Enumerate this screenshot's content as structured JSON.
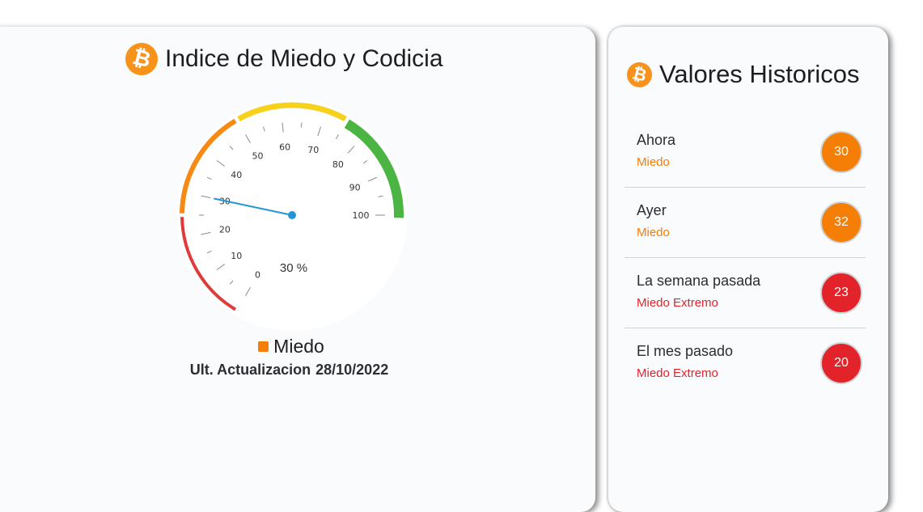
{
  "main": {
    "title": "Indice de Miedo y Codicia",
    "gauge": {
      "value": 30,
      "display": "30 %",
      "min": 0,
      "max": 100,
      "tick_labels": [
        "0",
        "10",
        "20",
        "30",
        "40",
        "50",
        "60",
        "70",
        "80",
        "90",
        "100"
      ],
      "needle_color": "#2496d3"
    },
    "classification": "Miedo",
    "classification_color": "#f47e06",
    "update_label": "Ult. Actualizacion",
    "update_date": "28/10/2022"
  },
  "history": {
    "title": "Valores Historicos",
    "items": [
      {
        "name": "Ahora",
        "classification": "Miedo",
        "value": "30",
        "color": "#f47e06"
      },
      {
        "name": "Ayer",
        "classification": "Miedo",
        "value": "32",
        "color": "#f47e06"
      },
      {
        "name": "La semana pasada",
        "classification": "Miedo Extremo",
        "value": "23",
        "color": "#e2242a"
      },
      {
        "name": "El mes pasado",
        "classification": "Miedo Extremo",
        "value": "20",
        "color": "#e2242a"
      }
    ]
  },
  "colors": {
    "extreme_fear": "#e03b3b",
    "fear": "#f68a12",
    "greed": "#f7d21c",
    "extreme_greed": "#4bb543",
    "bitcoin": "#f7931a"
  },
  "icons": {
    "bitcoin": "₿"
  }
}
